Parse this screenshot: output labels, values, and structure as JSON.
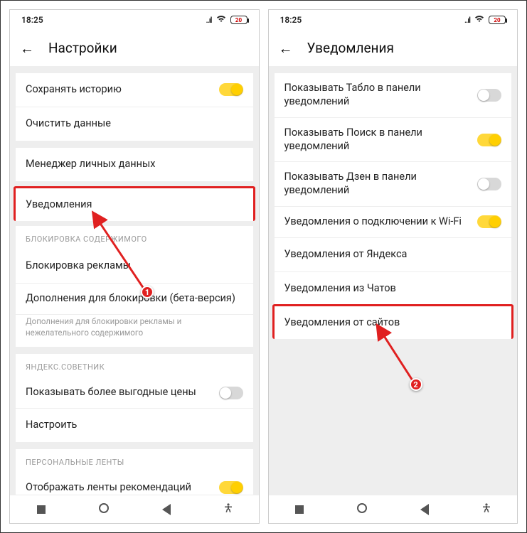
{
  "status": {
    "time": "18:25",
    "battery": "20"
  },
  "screen1": {
    "title": "Настройки",
    "rows": {
      "save_history": "Сохранять историю",
      "clear_data": "Очистить данные",
      "personal_data_mgr": "Менеджер личных данных",
      "notifications": "Уведомления"
    },
    "block_section": {
      "header": "БЛОКИРОВКА СОДЕРЖИМОГО",
      "ad_block": "Блокировка рекламы",
      "addons": "Дополнения для блокировки (бета-версия)",
      "addons_sub": "Дополнения для блокировки рекламы и нежелательного содержимого"
    },
    "advisor_section": {
      "header": "ЯНДЕКС.СОВЕТНИК",
      "better_prices": "Показывать более выгодные цены",
      "configure": "Настроить"
    },
    "feeds_section": {
      "header": "ПЕРСОНАЛЬНЫЕ ЛЕНТЫ",
      "show_feeds": "Отображать ленты рекомендаций"
    }
  },
  "screen2": {
    "title": "Уведомления",
    "rows": {
      "tablo": "Показывать Табло в панели уведомлений",
      "search": "Показывать Поиск в панели уведомлений",
      "zen": "Показывать Дзен в панели уведомлений",
      "wifi": "Уведомления о подключении к Wi-Fi",
      "yandex": "Уведомления от Яндекса",
      "chats": "Уведомления из Чатов",
      "sites": "Уведомления от сайтов"
    }
  },
  "markers": {
    "m1": "1",
    "m2": "2"
  }
}
